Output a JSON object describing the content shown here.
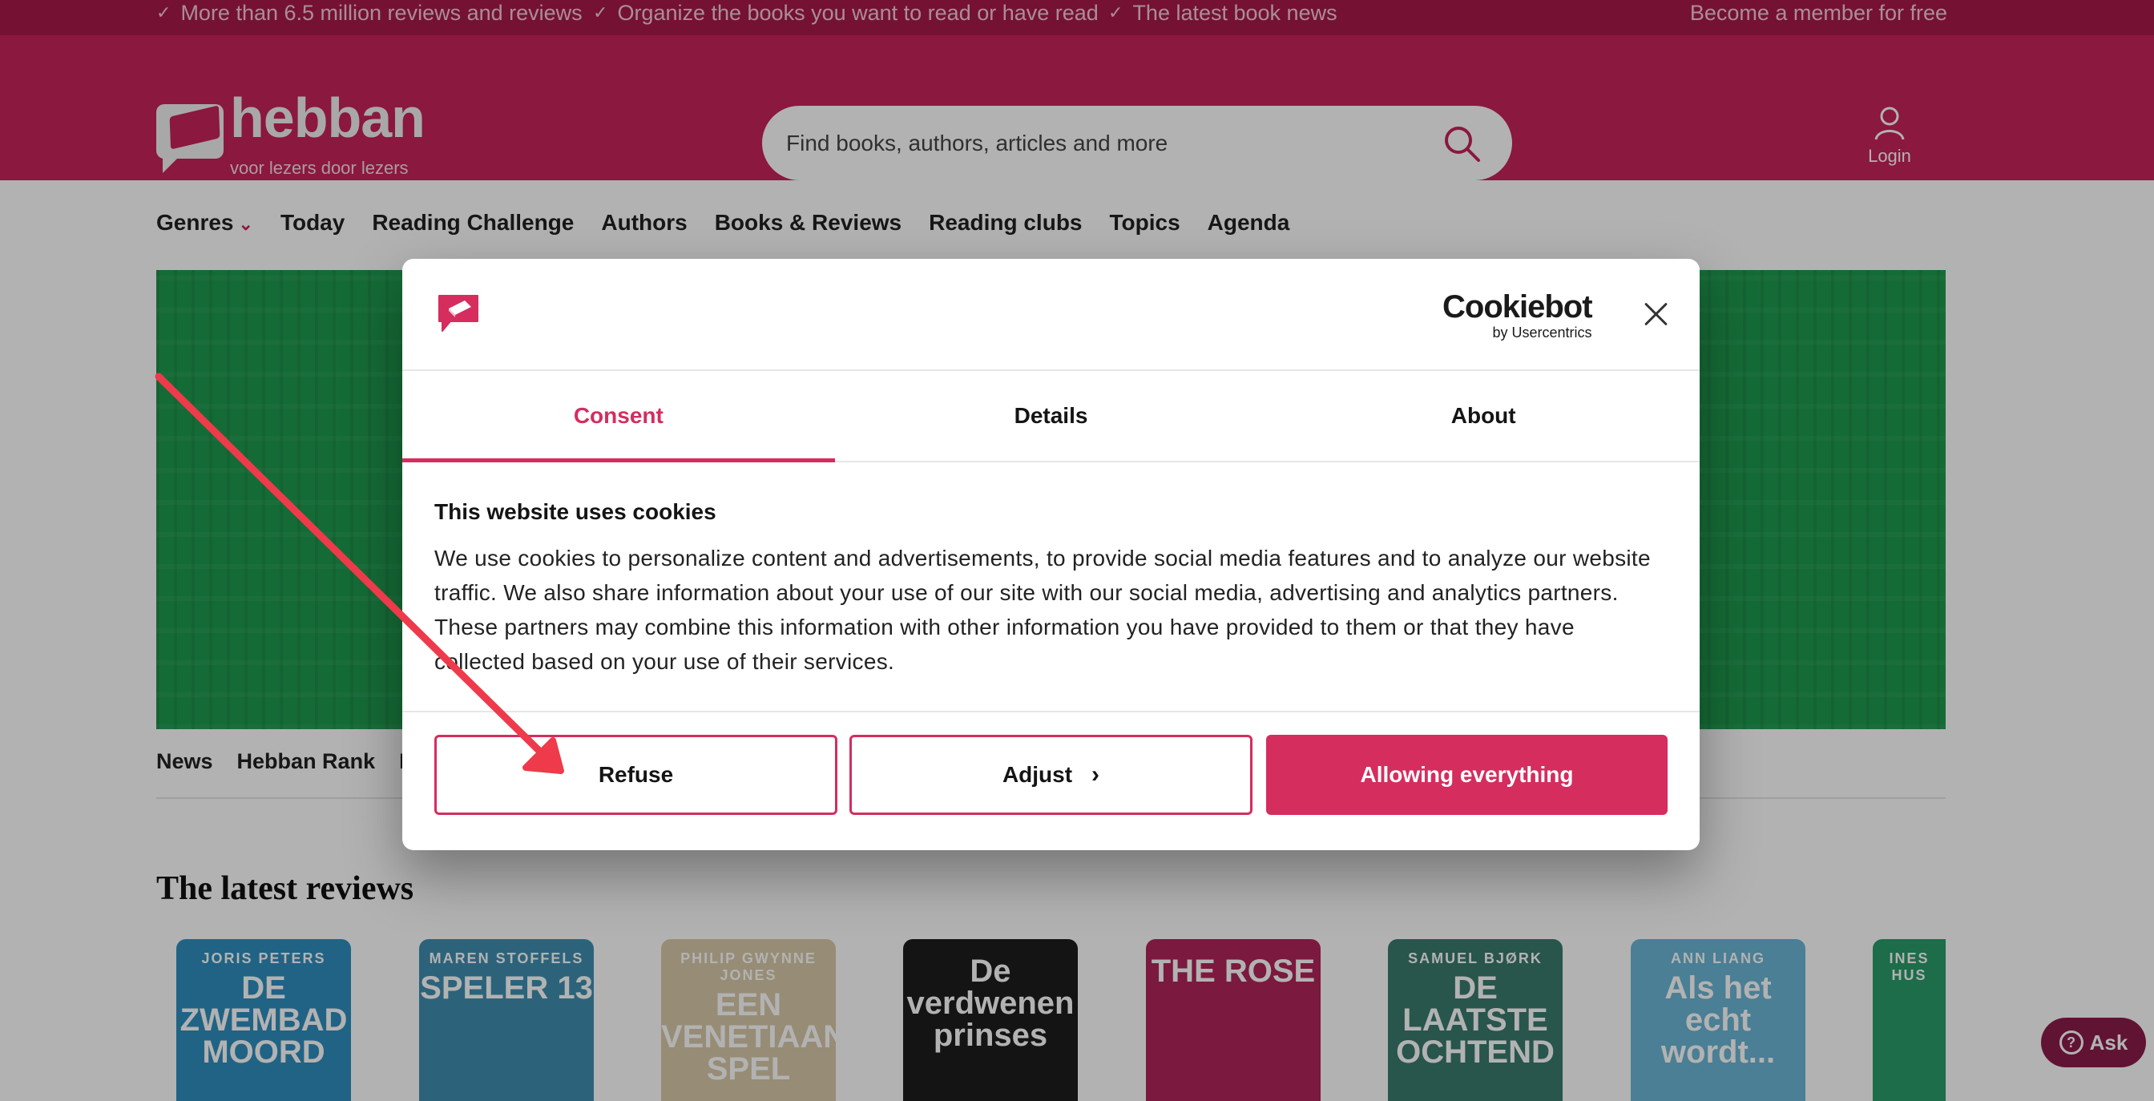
{
  "topbar": {
    "usps": [
      "More than 6.5 million reviews and reviews",
      "Organize the books you want to read or have read",
      "The latest book news"
    ],
    "member_link": "Become a member for free"
  },
  "header": {
    "logo_text": "hebban",
    "logo_tagline": "voor lezers door lezers",
    "search_placeholder": "Find books, authors, articles and more",
    "login_label": "Login"
  },
  "nav": {
    "items": [
      "Genres",
      "Today",
      "Reading Challenge",
      "Authors",
      "Books & Reviews",
      "Reading clubs",
      "Topics",
      "Agenda"
    ]
  },
  "subnav": {
    "items": [
      "News",
      "Hebban Rank",
      "N"
    ]
  },
  "latest": {
    "title": "The latest reviews",
    "books": [
      {
        "author": "JORIS PETERS",
        "title": "DE ZWEMBAD MOORD",
        "color": "#2f8fbf"
      },
      {
        "author": "MAREN STOFFELS",
        "title": "SPELER 13",
        "color": "#3f8fb0"
      },
      {
        "author": "PHILIP GWYNNE JONES",
        "title": "EEN VENETIAANS SPEL",
        "color": "#d9c9a8"
      },
      {
        "author": "",
        "title": "De verdwenen prinses",
        "color": "#1e1e1e"
      },
      {
        "author": "",
        "title": "THE ROSE",
        "color": "#b0245a"
      },
      {
        "author": "SAMUEL BJØRK",
        "title": "DE LAATSTE OCHTEND",
        "color": "#3a7a6e"
      },
      {
        "author": "ANN LIANG",
        "title": "Als het echt wordt...",
        "color": "#6ab6d6"
      },
      {
        "author": "INES HUS",
        "title": "",
        "color": "#2a9b6a"
      }
    ]
  },
  "ask_button": "Ask",
  "dialog": {
    "brand": "Cookiebot",
    "brand_sub": "by Usercentrics",
    "tabs": [
      {
        "label": "Consent",
        "active": true
      },
      {
        "label": "Details",
        "active": false
      },
      {
        "label": "About",
        "active": false
      }
    ],
    "heading": "This website uses cookies",
    "body": "We use cookies to personalize content and advertisements, to provide social media features and to analyze our website traffic. We also share information about your use of our site with our social media, advertising and analytics partners. These partners may combine this information with other information you have provided to them or that they have collected based on your use of their services.",
    "buttons": {
      "refuse": "Refuse",
      "adjust": "Adjust",
      "allow": "Allowing everything"
    }
  },
  "colors": {
    "brand_pink": "#c8235a",
    "topbar": "#a8194a",
    "cookiebot_accent": "#d42d5e",
    "banner_green": "#1f9a4e",
    "arrow": "#ee3a4a"
  }
}
